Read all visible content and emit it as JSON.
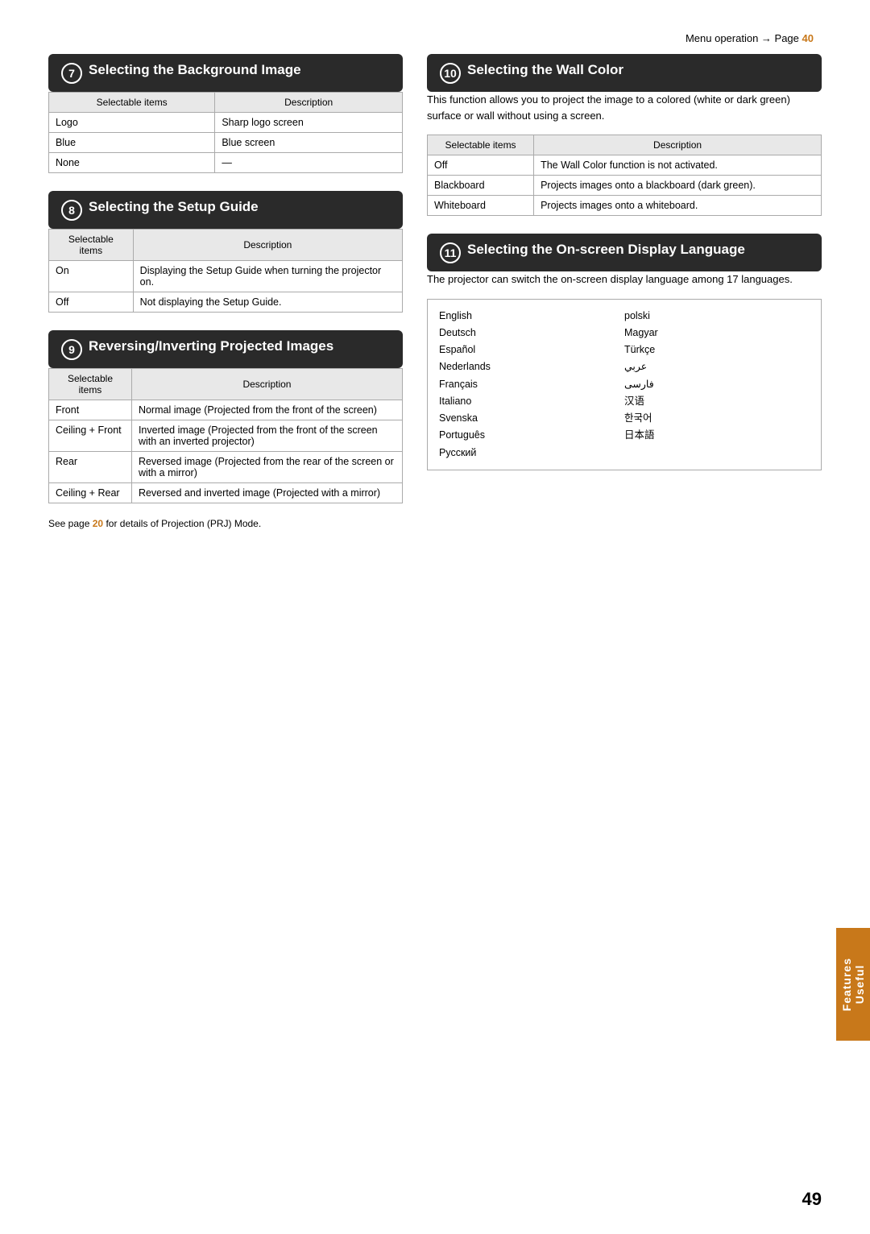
{
  "page": {
    "number": "49",
    "menu_ref_label": "Menu operation → Page",
    "menu_ref_page": "40"
  },
  "side_tab": {
    "line1": "Useful",
    "line2": "Features"
  },
  "section7": {
    "number": "7",
    "title": "Selecting the Background Image",
    "table": {
      "col1_header": "Selectable items",
      "col2_header": "Description",
      "rows": [
        {
          "item": "Logo",
          "desc": "Sharp logo screen"
        },
        {
          "item": "Blue",
          "desc": "Blue screen"
        },
        {
          "item": "None",
          "desc": "—"
        }
      ]
    }
  },
  "section8": {
    "number": "8",
    "title": "Selecting the Setup Guide",
    "table": {
      "col1_header": "Selectable items",
      "col2_header": "Description",
      "rows": [
        {
          "item": "On",
          "desc": "Displaying the Setup Guide when turning the projector on."
        },
        {
          "item": "Off",
          "desc": "Not displaying the Setup Guide."
        }
      ]
    }
  },
  "section9": {
    "number": "9",
    "title": "Reversing/Inverting Projected Images",
    "table": {
      "col1_header": "Selectable items",
      "col2_header": "Description",
      "rows": [
        {
          "item": "Front",
          "desc": "Normal image (Projected from the front of the screen)"
        },
        {
          "item": "Ceiling + Front",
          "desc": "Inverted image (Projected from the front of the screen with an inverted projector)"
        },
        {
          "item": "Rear",
          "desc": "Reversed image (Projected from the rear of the screen or with a mirror)"
        },
        {
          "item": "Ceiling + Rear",
          "desc": "Reversed and inverted image (Projected with a mirror)"
        }
      ]
    },
    "footer": "See page",
    "footer_page": "20",
    "footer_rest": " for details of Projection (PRJ) Mode."
  },
  "section10": {
    "number": "10",
    "title": "Selecting the Wall Color",
    "body": "This function allows you to project the image to a colored (white or dark green) surface or wall without using a screen.",
    "table": {
      "col1_header": "Selectable items",
      "col2_header": "Description",
      "rows": [
        {
          "item": "Off",
          "desc": "The Wall Color function is not activated."
        },
        {
          "item": "Blackboard",
          "desc": "Projects images onto a blackboard (dark green)."
        },
        {
          "item": "Whiteboard",
          "desc": "Projects images onto a whiteboard."
        }
      ]
    }
  },
  "section11": {
    "number": "11",
    "title": "Selecting the On-screen Display Language",
    "body": "The projector can switch the on-screen display language among 17 languages.",
    "languages_col1": [
      "English",
      "Deutsch",
      "Español",
      "Nederlands",
      "Français",
      "Italiano",
      "Svenska",
      "Português",
      "Русский"
    ],
    "languages_col2": [
      "polski",
      "Magyar",
      "Türkçe",
      "عربي",
      "فارسی",
      "汉语",
      "한국어",
      "日本語"
    ]
  }
}
